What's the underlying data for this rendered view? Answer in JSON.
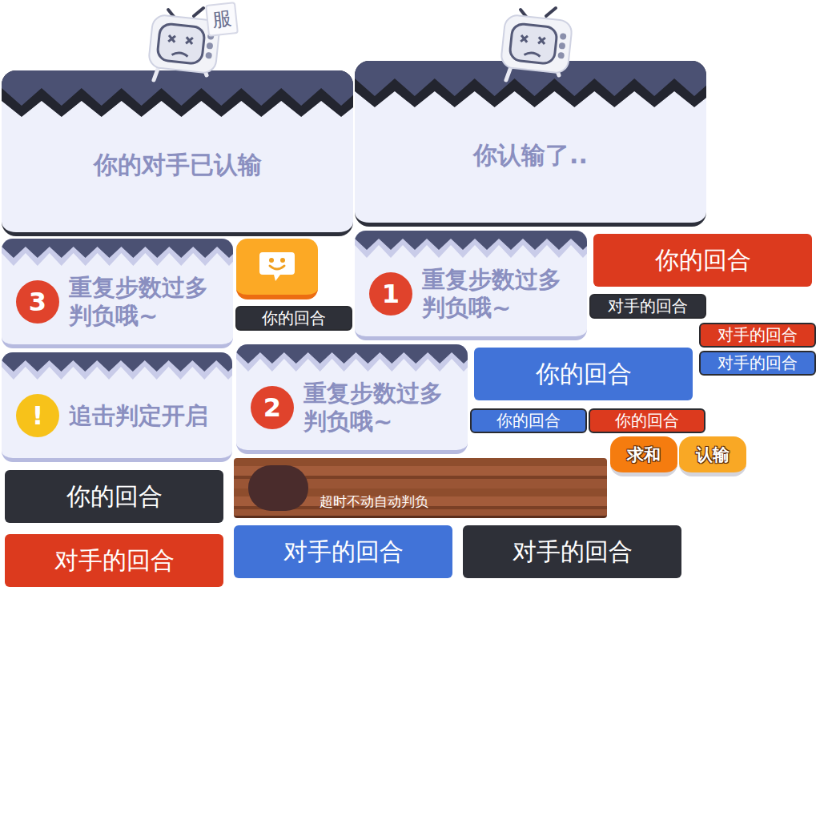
{
  "surrender_panels": [
    {
      "text": "你的对手已认输",
      "sign": "服"
    },
    {
      "text": "你认输了.."
    }
  ],
  "notice_panels": [
    {
      "badge": "3",
      "text": "重复步数过多判负哦~",
      "color": "#e0432c"
    },
    {
      "badge": "1",
      "text": "重复步数过多判负哦~",
      "color": "#e0432c"
    },
    {
      "badge": "!",
      "text": "追击判定开启",
      "color": "#f7c21a"
    },
    {
      "badge": "2",
      "text": "重复步数过多判负哦~",
      "color": "#e0432c"
    }
  ],
  "turn_labels": [
    {
      "text": "你的回合",
      "kind": "small",
      "color": "#2e3038"
    },
    {
      "text": "你的回合",
      "kind": "large",
      "color": "#dc3a1e"
    },
    {
      "text": "对手的回合",
      "kind": "small",
      "color": "#2e3038"
    },
    {
      "text": "对手的回合",
      "kind": "small",
      "color": "#dc3a1e"
    },
    {
      "text": "对手的回合",
      "kind": "small",
      "color": "#4173d8"
    },
    {
      "text": "你的回合",
      "kind": "large",
      "color": "#4173d8"
    },
    {
      "text": "你的回合",
      "kind": "small",
      "color": "#4173d8"
    },
    {
      "text": "你的回合",
      "kind": "small",
      "color": "#dc3a1e"
    },
    {
      "text": "你的回合",
      "kind": "large",
      "color": "#2e3038"
    },
    {
      "text": "对手的回合",
      "kind": "large",
      "color": "#dc3a1e"
    },
    {
      "text": "对手的回合",
      "kind": "large",
      "color": "#4173d8"
    },
    {
      "text": "对手的回合",
      "kind": "large",
      "color": "#2e3038"
    }
  ],
  "action_buttons": [
    {
      "label": "求和",
      "color": "#f57c0f"
    },
    {
      "label": "认输",
      "color": "#f9a825"
    }
  ],
  "timeout_bar": {
    "text": "超时不动自动判负"
  }
}
